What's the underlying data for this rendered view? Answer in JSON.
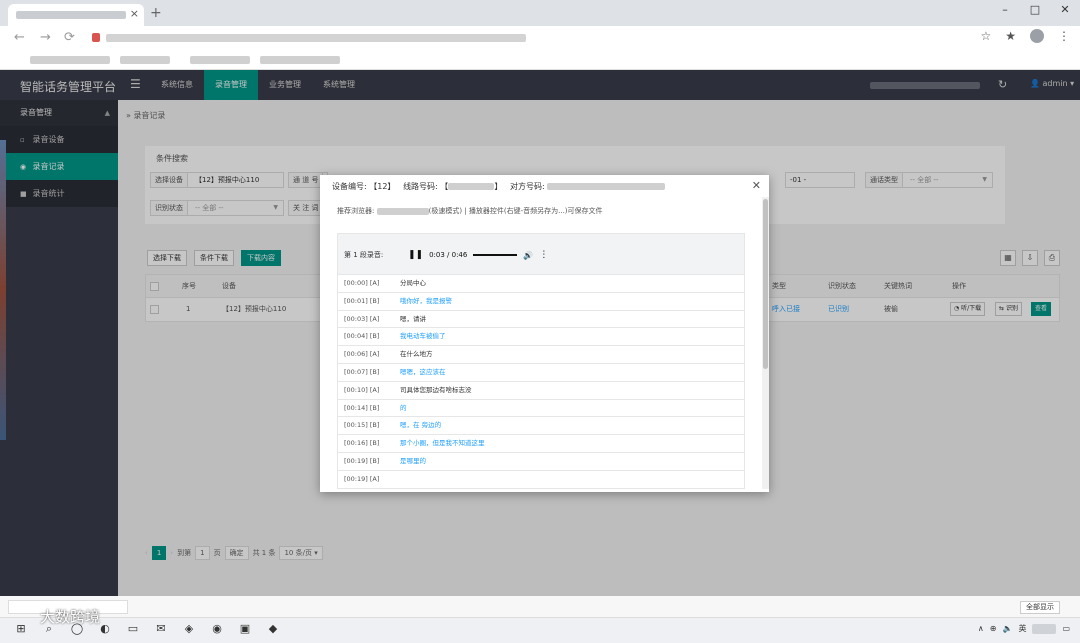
{
  "app": {
    "title": "智能话务管理平台",
    "nav": [
      "系统信息",
      "录音管理",
      "业务管理",
      "系统管理"
    ],
    "active_nav": "录音管理",
    "user": "admin"
  },
  "sidebar": {
    "group": "录音管理",
    "items": [
      {
        "label": "录音设备"
      },
      {
        "label": "录音记录"
      },
      {
        "label": "录音统计"
      }
    ]
  },
  "breadcrumb": "录音记录",
  "search": {
    "title": "条件搜索",
    "device_label": "选择设备",
    "device_value": "【12】预报中心110",
    "field2_label": "通 道 号",
    "call_type_label": "通话类型",
    "call_type_value": "-- 全部 --",
    "recog_label": "识别状态",
    "recog_value": "-- 全部 --",
    "field5_label": "关 注 词",
    "date_partial": "-01 -"
  },
  "toolbar": {
    "select_download": "选择下载",
    "condition_download": "条件下载",
    "download_content": "下载内容"
  },
  "table": {
    "headers": [
      "序号",
      "设备",
      "类型",
      "识别状态",
      "关键热词",
      "操作"
    ],
    "rows": [
      {
        "index": "1",
        "device": "【12】预报中心110",
        "type": "呼入已接",
        "status": "已识别",
        "keyword": "被偷",
        "btn_listen": "听/下载",
        "btn_recog": "识别",
        "btn_view": "查看"
      }
    ]
  },
  "pager": {
    "current": "1",
    "goto_label": "到第",
    "goto_value": "1",
    "page_unit": "页",
    "confirm": "确定",
    "total": "共 1 条",
    "page_size": "10 条/页"
  },
  "modal": {
    "device_label": "设备编号: 【12】",
    "line_label": "线路号码: 【",
    "line_suffix": "】",
    "peer_label": "对方号码:",
    "hint_prefix": "推荐浏览器:",
    "hint_mid": "(极速模式) | 播放器控件(右键-音频另存为...)可保存文件",
    "segment_label": "第 1 段录音:",
    "time": "0:03 / 0:46",
    "lines": [
      {
        "t": "[00:00] [A]",
        "text": "分局中心",
        "spk": "A"
      },
      {
        "t": "[00:01] [B]",
        "text": "哦你好，我是报警",
        "spk": "B"
      },
      {
        "t": "[00:03] [A]",
        "text": "嗯，请讲",
        "spk": "A"
      },
      {
        "t": "[00:04] [B]",
        "text": "我电动车被偷了",
        "spk": "B"
      },
      {
        "t": "[00:06] [A]",
        "text": "在什么地方",
        "spk": "A"
      },
      {
        "t": "[00:07] [B]",
        "text": "嗯嗯，这应该在",
        "spk": "B"
      },
      {
        "t": "[00:10] [A]",
        "text": "司具体您那边有啥标志没",
        "spk": "A"
      },
      {
        "t": "[00:14] [B]",
        "text": "的",
        "spk": "B"
      },
      {
        "t": "[00:15] [B]",
        "text": "嗯，在 旁边的",
        "spk": "B"
      },
      {
        "t": "[00:16] [B]",
        "text": "那个小圈，但是我不知道这里",
        "spk": "B"
      },
      {
        "t": "[00:19] [B]",
        "text": "是哪里的",
        "spk": "B"
      },
      {
        "t": "[00:19] [A]",
        "text": "",
        "spk": "A"
      }
    ]
  },
  "taskbar": {
    "show_all": "全部显示",
    "lang": "英"
  },
  "watermark": "大数跨境"
}
